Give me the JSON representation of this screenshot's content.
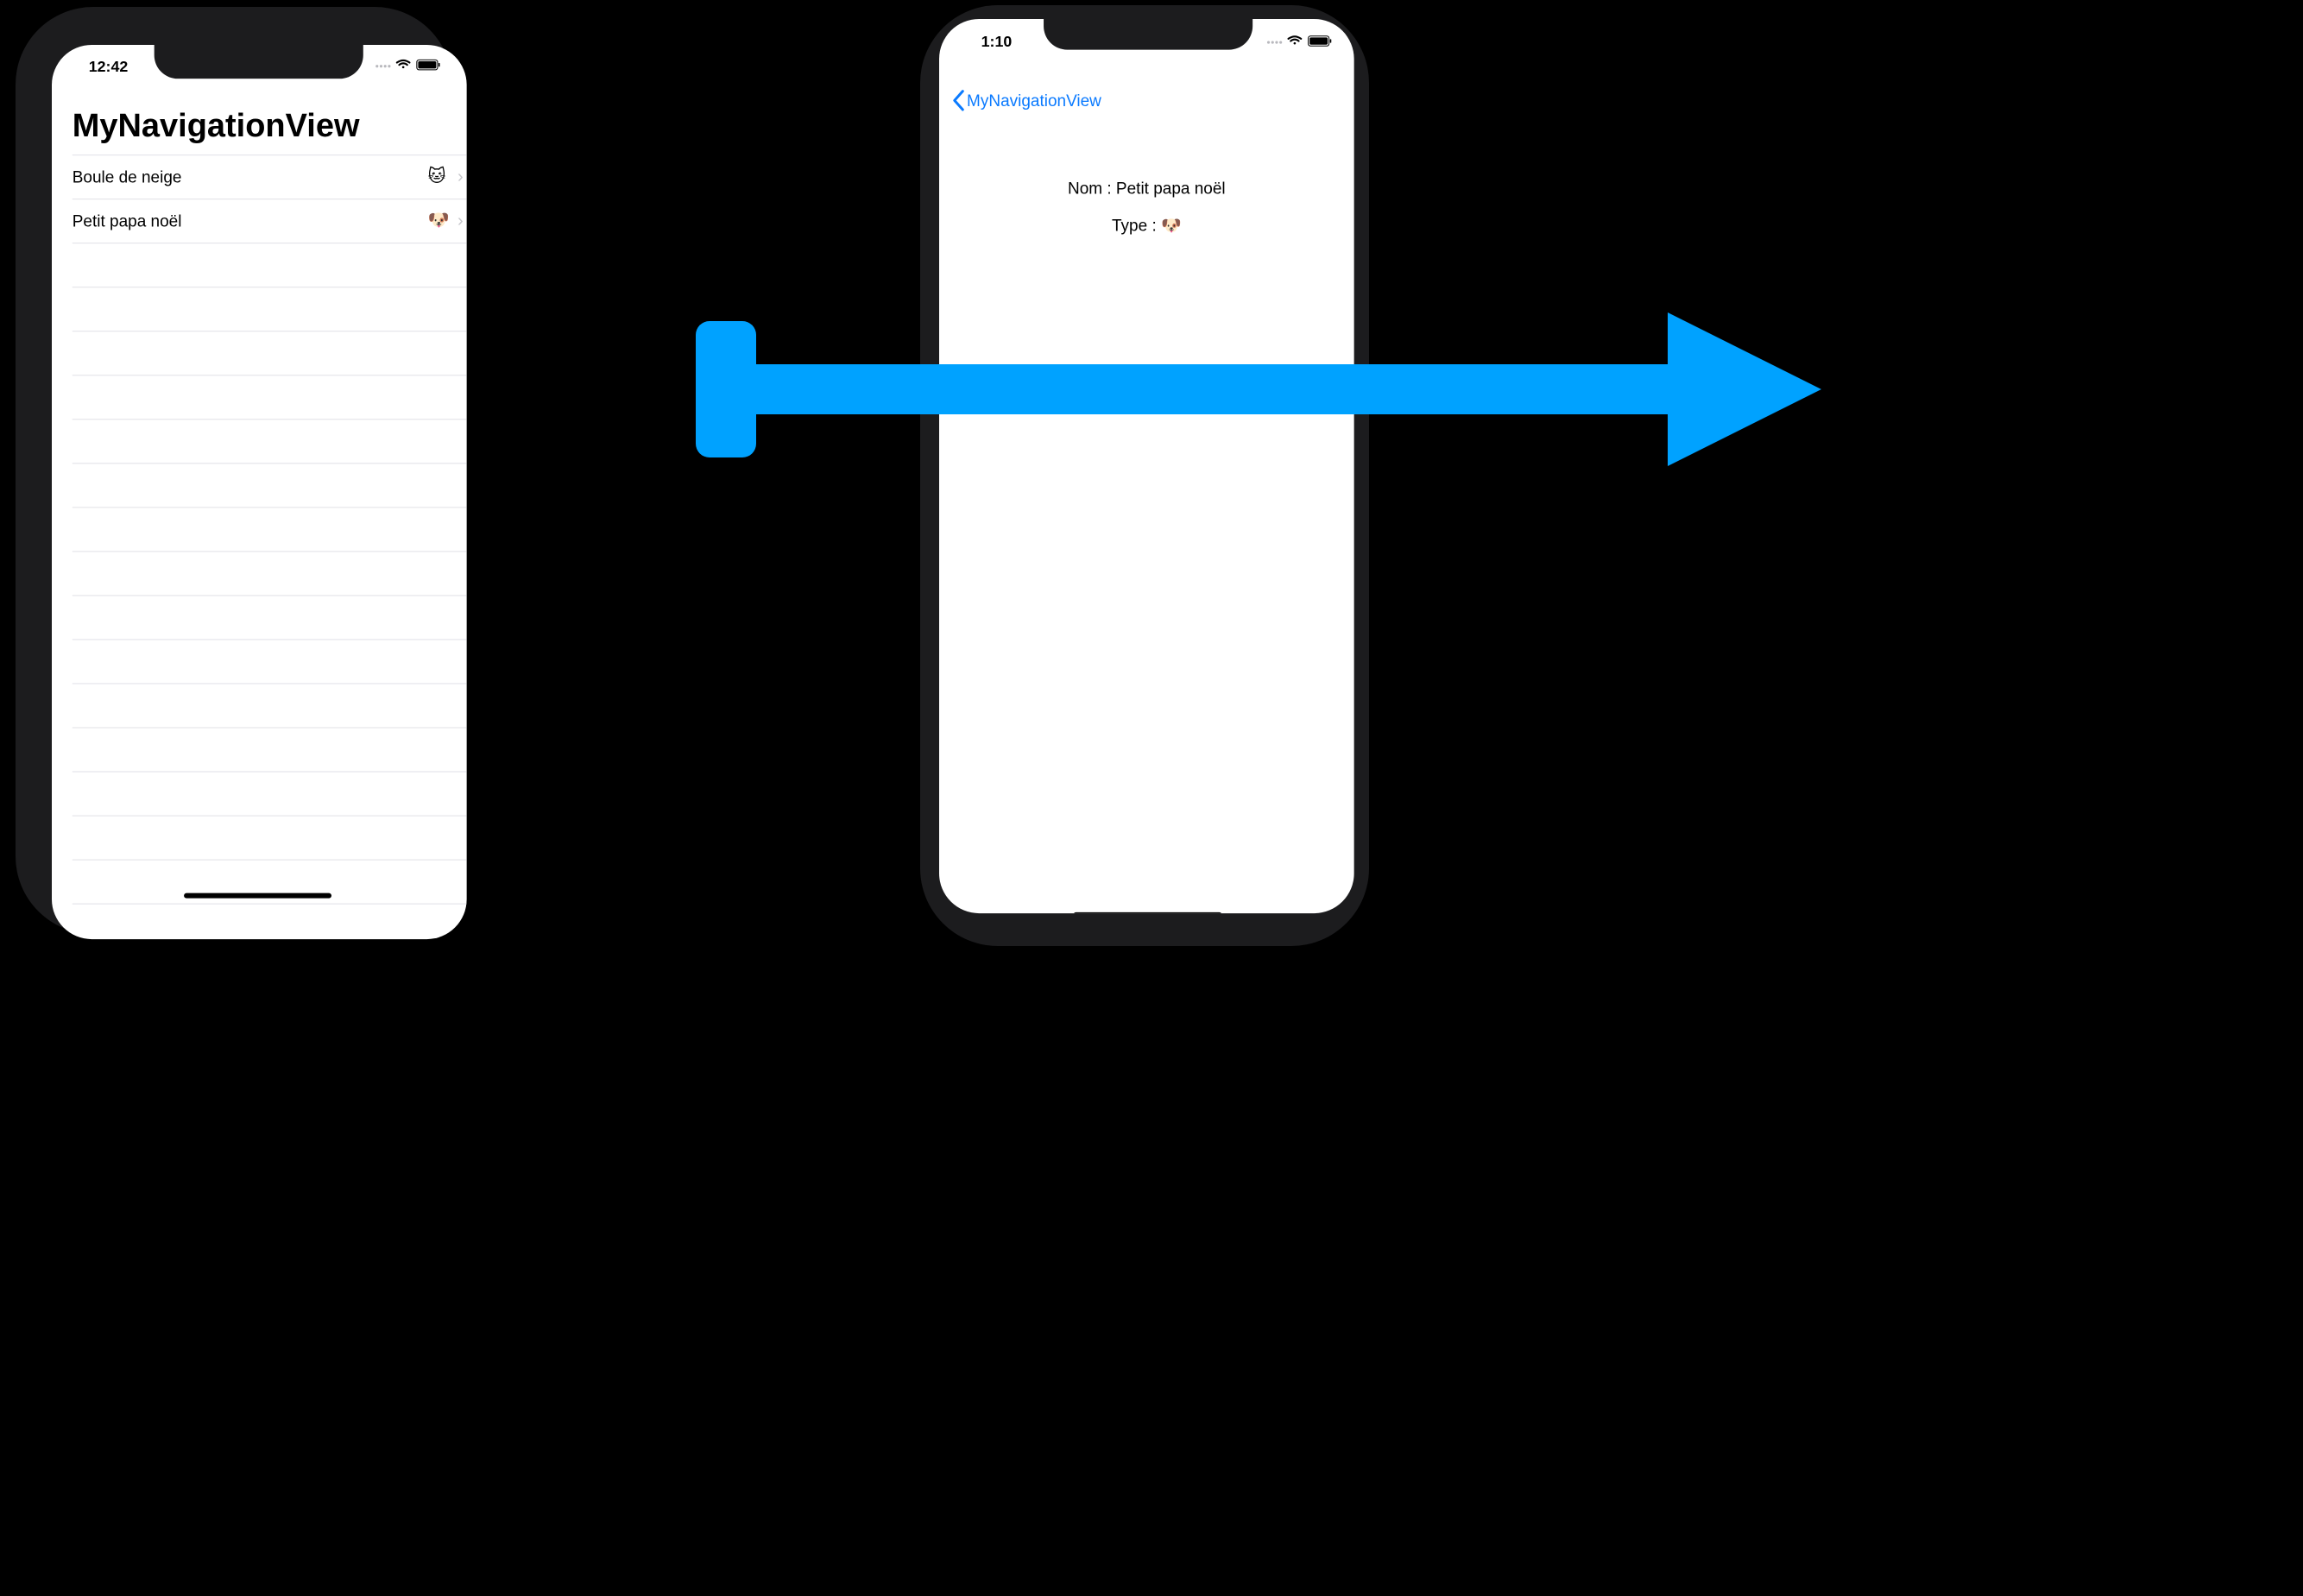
{
  "colors": {
    "accent": "#0a7aff",
    "arrow": "#00a2ff",
    "separator": "#e5e5ea",
    "bezel": "#1c1c1e"
  },
  "left_phone": {
    "status": {
      "time": "12:42",
      "icons": [
        "signal-dots-icon",
        "wifi-icon",
        "battery-icon"
      ]
    },
    "nav_title": "MyNavigationView",
    "list": [
      {
        "label": "Boule de neige",
        "emoji": "🐱",
        "icon": "cat-face-icon",
        "chevron": "›"
      },
      {
        "label": "Petit papa noël",
        "emoji": "🐶",
        "icon": "dog-face-icon",
        "chevron": "›"
      }
    ]
  },
  "right_phone": {
    "status": {
      "time": "1:10",
      "icons": [
        "signal-dots-icon",
        "wifi-icon",
        "battery-icon"
      ]
    },
    "back_button": {
      "label": "MyNavigationView",
      "icon": "chevron-left-icon"
    },
    "detail": {
      "name_line": "Nom : Petit papa noël",
      "type_prefix": "Type :",
      "type_emoji": "🐶"
    }
  },
  "annotation": {
    "type": "arrow",
    "icon": "right-arrow-icon"
  }
}
